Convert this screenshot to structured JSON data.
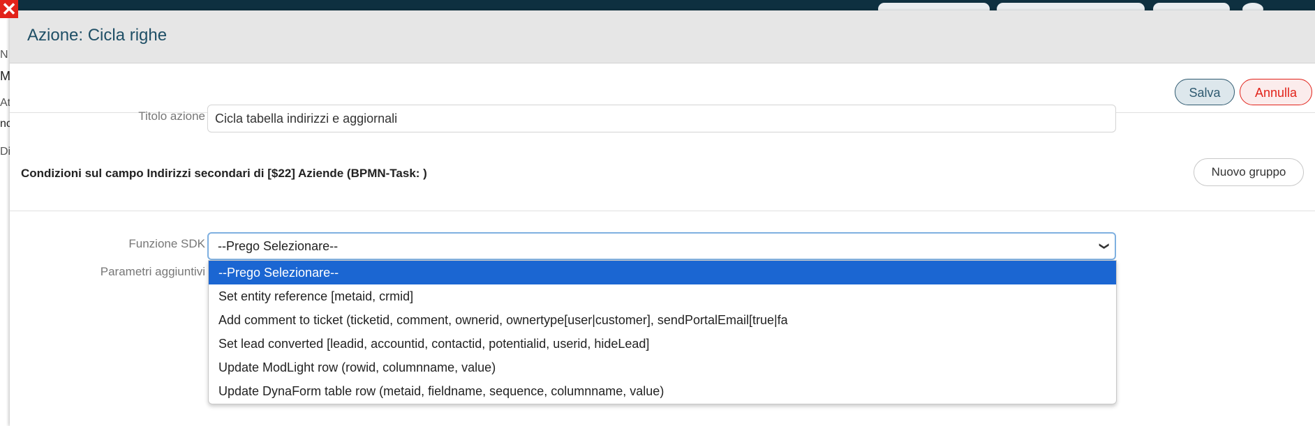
{
  "background": {
    "close_icon": "close-icon",
    "side_fragments": [
      "N",
      "M",
      "At",
      "nc",
      "Di"
    ]
  },
  "modal": {
    "title": "Azione: Cicla righe",
    "save_label": "Salva",
    "cancel_label": "Annulla",
    "action_title_label": "Titolo azione",
    "action_title_value": "Cicla tabella indirizzi e aggiornali",
    "conditions_title": "Condizioni sul campo Indirizzi secondari di [$22] Aziende (BPMN-Task: )",
    "new_group_label": "Nuovo gruppo",
    "sdk_function_label": "Funzione SDK",
    "extra_params_label": "Parametri aggiuntivi",
    "sdk_select": {
      "selected": "--Prego Selezionare--",
      "options": [
        "--Prego Selezionare--",
        "Set entity reference [metaid, crmid]",
        "Add comment to ticket (ticketid, comment, ownerid, ownertype[user|customer], sendPortalEmail[true|fa",
        "Set lead converted [leadid, accountid, contactid, potentialid, userid, hideLead]",
        "Update ModLight row (rowid, columnname, value)",
        "Update DynaForm table row (metaid, fieldname, sequence, columnname, value)"
      ]
    }
  },
  "colors": {
    "accent": "#1f4f66",
    "danger": "#e2231a",
    "selected_option": "#1b66d2"
  }
}
